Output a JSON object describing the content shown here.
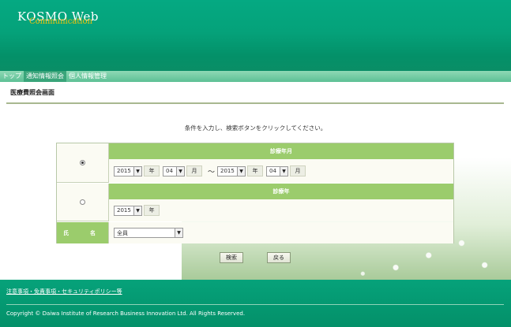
{
  "header": {
    "logo_main": "KOSMO Web",
    "logo_sub": "Communication"
  },
  "nav": {
    "items": [
      "トップ",
      "通知情報照会",
      "個人情報管理"
    ],
    "active_index": 1
  },
  "page": {
    "title": "医療費照会画面",
    "instruction": "条件を入力し、検索ボタンをクリックしてください。"
  },
  "form": {
    "section1": {
      "heading": "診療年月",
      "selected": true,
      "from_year": "2015",
      "from_month": "04",
      "to_year": "2015",
      "to_month": "04",
      "year_unit": "年",
      "month_unit": "月",
      "range_sep": "～"
    },
    "section2": {
      "heading": "診療年",
      "selected": false,
      "year": "2015",
      "year_unit": "年"
    },
    "name_row": {
      "label_1": "氏",
      "label_2": "名",
      "value": "全員"
    }
  },
  "buttons": {
    "search": "検索",
    "back": "戻る"
  },
  "footer": {
    "link": "注意事項・免責事項・セキュリティポリシー等",
    "copyright": "Copyright © Daiwa Institute of Research Business Innovation Ltd. All Rights Reserved."
  },
  "colors": {
    "header_green": "#05a982",
    "section_green": "#9bcc6c",
    "logo_sub_gold": "#f3c20a"
  }
}
